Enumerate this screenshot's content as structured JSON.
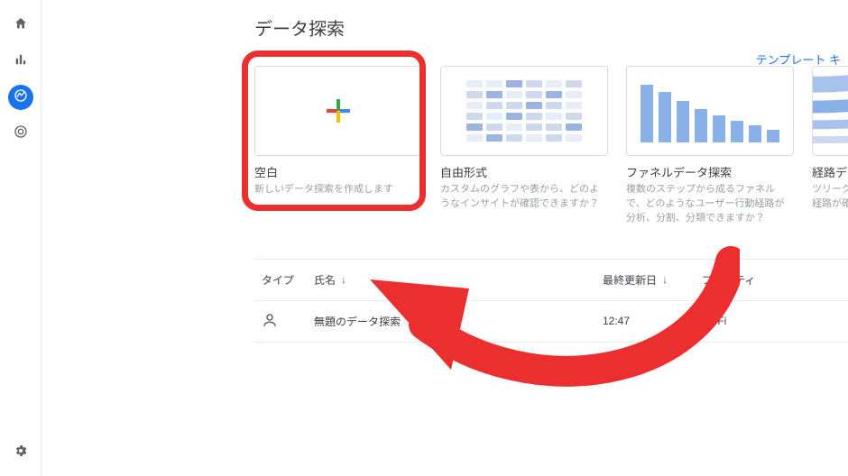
{
  "page": {
    "title": "データ探索",
    "template_link": "テンプレート キ"
  },
  "sidebar": {
    "items": [
      {
        "name": "home"
      },
      {
        "name": "reports"
      },
      {
        "name": "explore",
        "active": true
      },
      {
        "name": "advertising"
      }
    ],
    "bottom": {
      "name": "settings"
    }
  },
  "gallery": [
    {
      "key": "blank",
      "title": "空白",
      "desc": "新しいデータ探索を作成します"
    },
    {
      "key": "freeform",
      "title": "自由形式",
      "desc": "カスタムのグラフや表から、どのようなインサイトが確認できますか？"
    },
    {
      "key": "funnel",
      "title": "ファネルデータ探索",
      "desc": "複数のステップから成るファネルで、どのようなユーザー行動経路が分析、分割、分類できますか？"
    },
    {
      "key": "path",
      "title": "経路データ探索",
      "desc": "ツリーグラフから、ユーザーのど動経路が確認できますか？"
    }
  ],
  "table": {
    "headers": {
      "type": "タイプ",
      "name": "氏名",
      "owner": "ー",
      "updated": "最終更新日",
      "property": "プロパティ"
    },
    "rows": [
      {
        "type_icon": "person",
        "name": "無題のデータ探索",
        "owner": "",
        "updated": "12:47",
        "property": "BloFi"
      }
    ]
  },
  "annotation": {
    "highlight_card": "blank",
    "arrow_color": "#eb2f2f"
  }
}
